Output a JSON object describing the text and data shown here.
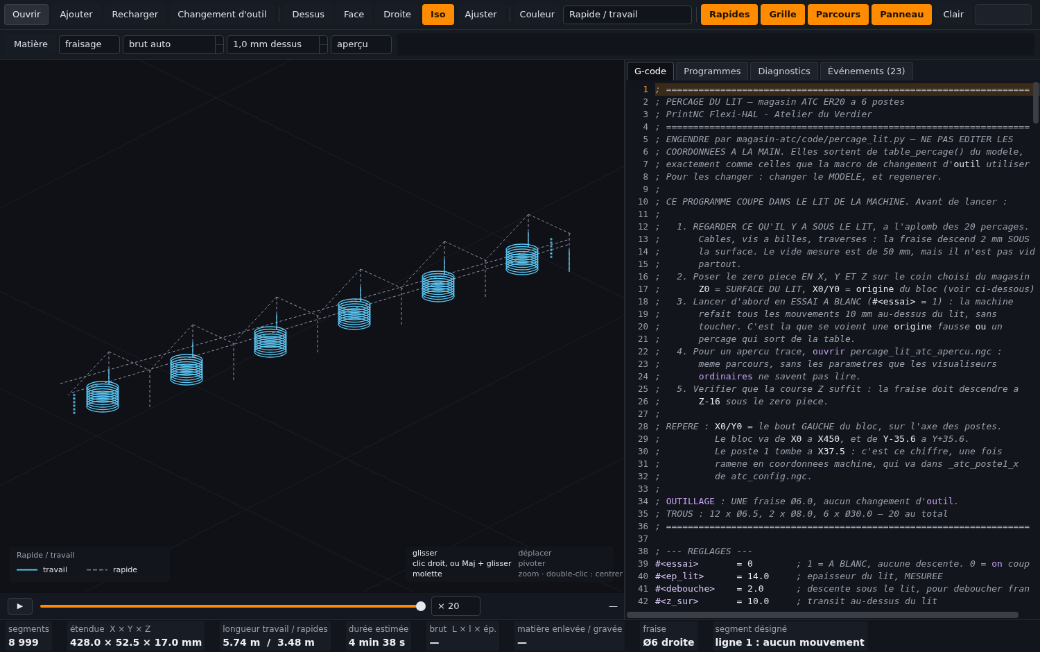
{
  "toolbar": {
    "groups": [
      {
        "items": [
          {
            "kind": "button",
            "label": "Ouvrir",
            "on": false,
            "focused": true
          },
          {
            "kind": "button",
            "label": "Ajouter",
            "on": false,
            "focused": false
          },
          {
            "kind": "button",
            "label": "Recharger",
            "on": false,
            "focused": false
          },
          {
            "kind": "button",
            "label": "Changement d'outil",
            "on": false,
            "focused": false
          }
        ]
      },
      {
        "items": [
          {
            "kind": "button",
            "label": "Dessus",
            "on": false,
            "focused": false
          },
          {
            "kind": "button",
            "label": "Face",
            "on": false,
            "focused": false
          },
          {
            "kind": "button",
            "label": "Droite",
            "on": false,
            "focused": false
          },
          {
            "kind": "button",
            "label": "Iso",
            "on": true,
            "focused": false
          },
          {
            "kind": "button",
            "label": "Ajuster",
            "on": false,
            "focused": false
          }
        ]
      },
      {
        "items": [
          {
            "kind": "label",
            "label": "Couleur"
          },
          {
            "kind": "select",
            "label": "Rapide / travail"
          }
        ]
      },
      {
        "items": [
          {
            "kind": "button",
            "label": "Rapides",
            "on": true,
            "focused": false
          },
          {
            "kind": "button",
            "label": "Grille",
            "on": true,
            "focused": false
          },
          {
            "kind": "button",
            "label": "Parcours",
            "on": true,
            "focused": false
          },
          {
            "kind": "button",
            "label": "Panneau",
            "on": true,
            "focused": false
          },
          {
            "kind": "button",
            "label": "Clair",
            "on": false,
            "focused": false
          }
        ]
      }
    ]
  },
  "material_bar": {
    "items": [
      {
        "kind": "label",
        "value": "Matière"
      },
      {
        "kind": "input",
        "value": "fraisage"
      },
      {
        "kind": "spinbox",
        "value": "brut auto"
      },
      {
        "kind": "spinbox",
        "value": "1,0 mm dessus"
      },
      {
        "kind": "input",
        "value": "aperçu"
      }
    ]
  },
  "viewport": {
    "legend": {
      "title": "Rapide / travail",
      "items": [
        {
          "kind": "solid",
          "label": "travail"
        },
        {
          "kind": "dashed",
          "label": "rapide"
        }
      ]
    },
    "help": [
      {
        "gesture": "glisser",
        "action": "déplacer"
      },
      {
        "gesture": "clic droit, ou Maj + glisser",
        "action": "pivoter"
      },
      {
        "gesture": "molette",
        "action": "zoom · double-clic : centrer"
      }
    ]
  },
  "playback": {
    "play": "▶",
    "level": 1,
    "speed": "× 20",
    "collapse": "—"
  },
  "panel": {
    "tabs": [
      {
        "label": "G-code",
        "selected": true
      },
      {
        "label": "Programmes",
        "selected": false
      },
      {
        "label": "Diagnostics",
        "selected": false
      },
      {
        "label": "Événements (23)",
        "selected": false
      }
    ],
    "lines": [
      {
        "number": "1",
        "current": true,
        "parts": [
          {
            "kind": "comment",
            "text": "; ==================================================================="
          }
        ]
      },
      {
        "number": "2",
        "current": false,
        "parts": [
          {
            "kind": "comment",
            "text": "; PERCAGE DU LIT — magasin ATC ER20 a 6 postes"
          }
        ]
      },
      {
        "number": "3",
        "current": false,
        "parts": [
          {
            "kind": "comment",
            "text": "; PrintNC Flexi-HAL - Atelier du Verdier"
          }
        ]
      },
      {
        "number": "4",
        "current": false,
        "parts": [
          {
            "kind": "comment",
            "text": "; ==================================================================="
          }
        ]
      },
      {
        "number": "5",
        "current": false,
        "parts": [
          {
            "kind": "comment",
            "text": "; ENGENDRE par magasin-atc/code/percage_lit.py — NE PAS EDITER LES"
          }
        ]
      },
      {
        "number": "6",
        "current": false,
        "parts": [
          {
            "kind": "comment",
            "text": "; COORDONNEES A LA MAIN. Elles sortent de table_percage() du modele,"
          }
        ]
      },
      {
        "number": "7",
        "current": false,
        "parts": [
          {
            "kind": "comment",
            "text": "; exactement comme celles que la macro de changement d'"
          },
          {
            "kind": "code",
            "text": "outil"
          },
          {
            "kind": "comment",
            "text": " utiliser"
          }
        ]
      },
      {
        "number": "8",
        "current": false,
        "parts": [
          {
            "kind": "comment",
            "text": "; Pour les changer : changer le MODELE, et regenerer."
          }
        ]
      },
      {
        "number": "9",
        "current": false,
        "parts": [
          {
            "kind": "comment",
            "text": ";"
          }
        ]
      },
      {
        "number": "10",
        "current": false,
        "parts": [
          {
            "kind": "comment",
            "text": "; CE PROGRAMME COUPE DANS LE LIT DE LA MACHINE. Avant de lancer :"
          }
        ]
      },
      {
        "number": "11",
        "current": false,
        "parts": [
          {
            "kind": "comment",
            "text": ";"
          }
        ]
      },
      {
        "number": "12",
        "current": false,
        "parts": [
          {
            "kind": "comment",
            "text": ";   1. REGARDER CE QU'IL Y A SOUS LE LIT, a l'aplomb des 20 percages."
          }
        ]
      },
      {
        "number": "13",
        "current": false,
        "parts": [
          {
            "kind": "comment",
            "text": ";       Cables, vis a billes, traverses : la fraise descend 2 mm SOUS"
          }
        ]
      },
      {
        "number": "14",
        "current": false,
        "parts": [
          {
            "kind": "comment",
            "text": ";       la surface. Le vide mesure est de 50 mm, mais il n'est pas vid"
          }
        ]
      },
      {
        "number": "15",
        "current": false,
        "parts": [
          {
            "kind": "comment",
            "text": ";       partout."
          }
        ]
      },
      {
        "number": "16",
        "current": false,
        "parts": [
          {
            "kind": "comment",
            "text": ";   2. Poser le zero piece EN X, Y ET Z sur le coin choisi du magasin"
          }
        ]
      },
      {
        "number": "17",
        "current": false,
        "parts": [
          {
            "kind": "comment",
            "text": ";       "
          },
          {
            "kind": "code",
            "text": "Z0"
          },
          {
            "kind": "comment",
            "text": " = SURFACE DU LIT, "
          },
          {
            "kind": "code",
            "text": "X0/Y0"
          },
          {
            "kind": "comment",
            "text": " = "
          },
          {
            "kind": "code",
            "text": "origine"
          },
          {
            "kind": "comment",
            "text": " du bloc (voir ci-dessous)"
          }
        ]
      },
      {
        "number": "18",
        "current": false,
        "parts": [
          {
            "kind": "comment",
            "text": ";   3. Lancer d'abord en ESSAI A BLANC ("
          },
          {
            "kind": "code",
            "text": "#<essai>"
          },
          {
            "kind": "comment",
            "text": " = 1) : la machine"
          }
        ]
      },
      {
        "number": "19",
        "current": false,
        "parts": [
          {
            "kind": "comment",
            "text": ";       refait tous les mouvements 10 mm au-dessus du lit, sans"
          }
        ]
      },
      {
        "number": "20",
        "current": false,
        "parts": [
          {
            "kind": "comment",
            "text": ";       toucher. C'est la que se voient une "
          },
          {
            "kind": "code",
            "text": "origine"
          },
          {
            "kind": "comment",
            "text": " fausse "
          },
          {
            "kind": "code",
            "text": "ou"
          },
          {
            "kind": "comment",
            "text": " un"
          }
        ]
      },
      {
        "number": "21",
        "current": false,
        "parts": [
          {
            "kind": "comment",
            "text": ";       percage qui sort de la table."
          }
        ]
      },
      {
        "number": "22",
        "current": false,
        "parts": [
          {
            "kind": "comment",
            "text": ";   4. Pour un apercu trace, "
          },
          {
            "kind": "keyword",
            "text": "ouvrir"
          },
          {
            "kind": "comment",
            "text": " percage_lit_atc_apercu.ngc :"
          }
        ]
      },
      {
        "number": "23",
        "current": false,
        "parts": [
          {
            "kind": "comment",
            "text": ";       meme parcours, sans les parametres que les visualiseurs"
          }
        ]
      },
      {
        "number": "24",
        "current": false,
        "parts": [
          {
            "kind": "comment",
            "text": ";       "
          },
          {
            "kind": "keyword",
            "text": "ordinaires"
          },
          {
            "kind": "comment",
            "text": " ne savent pas lire."
          }
        ]
      },
      {
        "number": "25",
        "current": false,
        "parts": [
          {
            "kind": "comment",
            "text": ";   5. Verifier que la course Z suffit : la fraise doit descendre a"
          }
        ]
      },
      {
        "number": "26",
        "current": false,
        "parts": [
          {
            "kind": "comment",
            "text": ";       "
          },
          {
            "kind": "code",
            "text": "Z-16"
          },
          {
            "kind": "comment",
            "text": " sous le zero piece."
          }
        ]
      },
      {
        "number": "27",
        "current": false,
        "parts": [
          {
            "kind": "comment",
            "text": ";"
          }
        ]
      },
      {
        "number": "28",
        "current": false,
        "parts": [
          {
            "kind": "comment",
            "text": "; REPERE : "
          },
          {
            "kind": "code",
            "text": "X0/Y0"
          },
          {
            "kind": "comment",
            "text": " = le bout GAUCHE du bloc, sur l'axe des postes."
          }
        ]
      },
      {
        "number": "29",
        "current": false,
        "parts": [
          {
            "kind": "comment",
            "text": ";          Le bloc va de "
          },
          {
            "kind": "code",
            "text": "X0"
          },
          {
            "kind": "comment",
            "text": " a "
          },
          {
            "kind": "code",
            "text": "X450"
          },
          {
            "kind": "comment",
            "text": ", et de "
          },
          {
            "kind": "code",
            "text": "Y-35.6"
          },
          {
            "kind": "comment",
            "text": " a Y+35.6."
          }
        ]
      },
      {
        "number": "30",
        "current": false,
        "parts": [
          {
            "kind": "comment",
            "text": ";          Le poste 1 tombe a "
          },
          {
            "kind": "code",
            "text": "X37.5"
          },
          {
            "kind": "comment",
            "text": " : c'est ce chiffre, une fois"
          }
        ]
      },
      {
        "number": "31",
        "current": false,
        "parts": [
          {
            "kind": "comment",
            "text": ";          ramene en coordonnees machine, qui va dans _atc_poste1_x"
          }
        ]
      },
      {
        "number": "32",
        "current": false,
        "parts": [
          {
            "kind": "comment",
            "text": ";          de atc_config.ngc."
          }
        ]
      },
      {
        "number": "33",
        "current": false,
        "parts": [
          {
            "kind": "comment",
            "text": ";"
          }
        ]
      },
      {
        "number": "34",
        "current": false,
        "parts": [
          {
            "kind": "comment",
            "text": "; "
          },
          {
            "kind": "keyword",
            "text": "OUTILLAGE"
          },
          {
            "kind": "comment",
            "text": " : UNE fraise Ø6.0, aucun changement d'"
          },
          {
            "kind": "keyword",
            "text": "outil"
          },
          {
            "kind": "comment",
            "text": "."
          }
        ]
      },
      {
        "number": "35",
        "current": false,
        "parts": [
          {
            "kind": "comment",
            "text": "; TROUS : 12 x Ø6.5, 2 x Ø8.0, 6 x Ø30.0 — 20 au total"
          }
        ]
      },
      {
        "number": "36",
        "current": false,
        "parts": [
          {
            "kind": "comment",
            "text": "; ==================================================================="
          }
        ]
      },
      {
        "number": "37",
        "current": false
      },
      {
        "number": "38",
        "current": false,
        "parts": [
          {
            "kind": "comment",
            "text": "; --- REGLAGES ---"
          }
        ]
      },
      {
        "number": "39",
        "current": false,
        "parts": [
          {
            "kind": "variable",
            "text": "#<essai>"
          },
          {
            "kind": "code",
            "text": "       = 0        "
          },
          {
            "kind": "comment",
            "text": "; 1 = A BLANC, aucune descente. 0 = "
          },
          {
            "kind": "keyword",
            "text": "on"
          },
          {
            "kind": "comment",
            "text": " coup"
          }
        ]
      },
      {
        "number": "40",
        "current": false,
        "parts": [
          {
            "kind": "variable",
            "text": "#<ep_lit>"
          },
          {
            "kind": "code",
            "text": "      = 14.0     "
          },
          {
            "kind": "comment",
            "text": "; epaisseur du lit, MESUREE"
          }
        ]
      },
      {
        "number": "41",
        "current": false,
        "parts": [
          {
            "kind": "variable",
            "text": "#<debouche>"
          },
          {
            "kind": "code",
            "text": "    = 2.0      "
          },
          {
            "kind": "comment",
            "text": "; descente sous le lit, pour deboucher fran"
          }
        ]
      },
      {
        "number": "42",
        "current": false,
        "parts": [
          {
            "kind": "variable",
            "text": "#<z_sur>"
          },
          {
            "kind": "code",
            "text": "       = 10.0     "
          },
          {
            "kind": "comment",
            "text": "; transit au-dessus du lit"
          }
        ]
      }
    ]
  },
  "status_bar": [
    {
      "label": "segments",
      "value": "8 999"
    },
    {
      "label": "étendue  X × Y × Z",
      "value": "428.0 × 52.5 × 17.0 mm"
    },
    {
      "label": "longueur travail / rapides",
      "value": "5.74 m  /  3.48 m"
    },
    {
      "label": "durée estimée",
      "value": "4 min 38 s"
    },
    {
      "label": "brut  L × l × ép.",
      "value": "—"
    },
    {
      "label": "matière enlevée / gravée",
      "value": "—"
    },
    {
      "label": "fraise",
      "value": "Ø6 droite"
    },
    {
      "label": "segment désigné",
      "value": "ligne 1 : aucun mouvement"
    }
  ]
}
